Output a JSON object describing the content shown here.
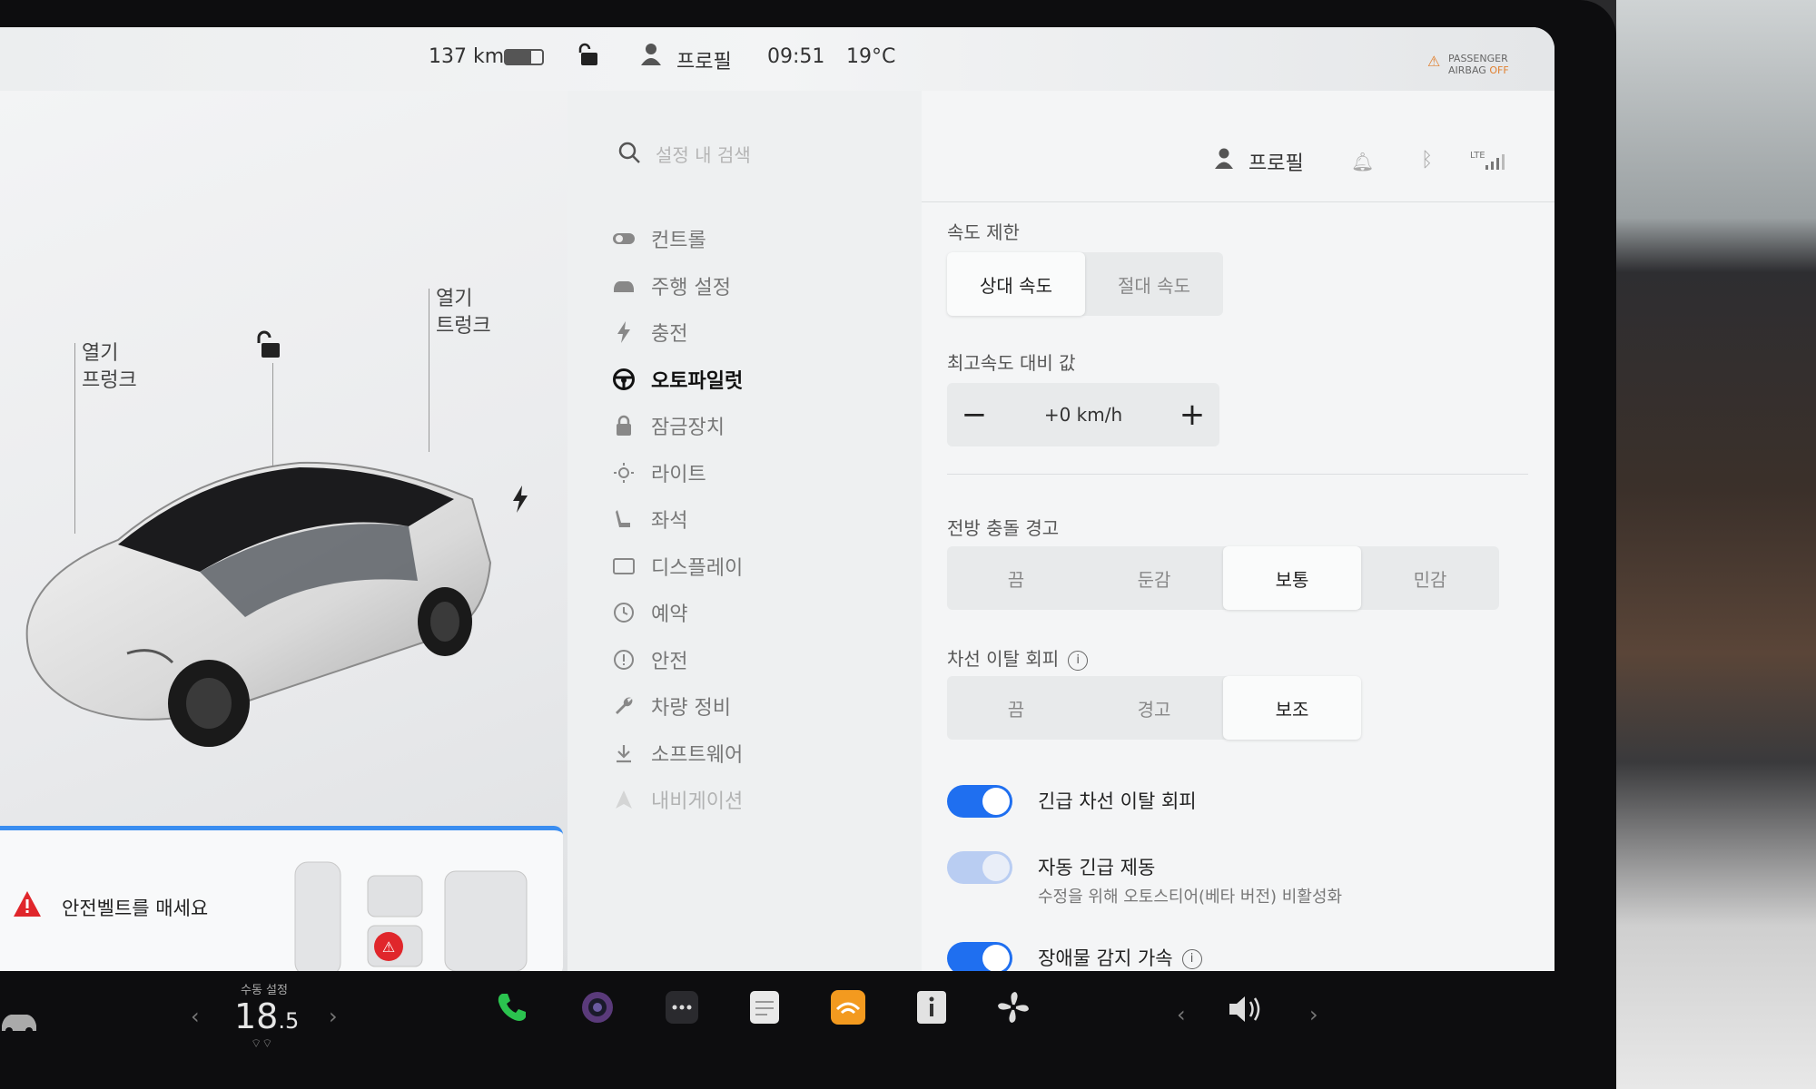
{
  "status_bar": {
    "range": "137 km",
    "battery_level": 0.7,
    "profile": "프로필",
    "time": "09:51",
    "temperature": "19°C",
    "airbag_line1": "PASSENGER",
    "airbag_line2": "AIRBAG",
    "airbag_state": "OFF"
  },
  "left_panel": {
    "frunk_state": "열기",
    "frunk_label": "프렁크",
    "trunk_state": "열기",
    "trunk_label": "트렁크",
    "alert_text": "안전벨트를 매세요"
  },
  "search": {
    "placeholder": "설정 내 검색"
  },
  "menu": {
    "items": [
      {
        "label": "컨트롤",
        "icon": "toggle-icon"
      },
      {
        "label": "주행 설정",
        "icon": "car-icon"
      },
      {
        "label": "충전",
        "icon": "lightning-icon"
      },
      {
        "label": "오토파일럿",
        "icon": "steering-wheel-icon",
        "active": true
      },
      {
        "label": "잠금장치",
        "icon": "lock-icon"
      },
      {
        "label": "라이트",
        "icon": "light-icon"
      },
      {
        "label": "좌석",
        "icon": "seat-icon"
      },
      {
        "label": "디스플레이",
        "icon": "display-icon"
      },
      {
        "label": "예약",
        "icon": "clock-icon"
      },
      {
        "label": "안전",
        "icon": "safety-icon"
      },
      {
        "label": "차량 정비",
        "icon": "wrench-icon"
      },
      {
        "label": "소프트웨어",
        "icon": "download-icon"
      },
      {
        "label": "내비게이션",
        "icon": "navigation-icon"
      }
    ]
  },
  "content": {
    "profile": "프로필",
    "lte": "LTE",
    "speed_limit": {
      "label": "속도 제한",
      "options": [
        "상대 속도",
        "절대 속도"
      ],
      "selected": 0
    },
    "offset": {
      "label": "최고속도 대비 값",
      "minus": "−",
      "value": "+0 km/h",
      "plus": "+"
    },
    "fcw": {
      "label": "전방 충돌 경고",
      "options": [
        "끔",
        "둔감",
        "보통",
        "민감"
      ],
      "selected": 2
    },
    "lane_departure": {
      "label": "차선 이탈 회피",
      "info": "i",
      "options": [
        "끔",
        "경고",
        "보조"
      ],
      "selected": 2
    },
    "toggles": {
      "emergency_lane": {
        "label": "긴급 차선 이탈 회피",
        "on": true
      },
      "aeb": {
        "label": "자동 긴급 제동",
        "sub": "수정을 위해 오토스티어(베타 버전) 비활성화",
        "on": true
      },
      "obstacle": {
        "label": "장애물 감지 가속",
        "info": "i",
        "on": true
      }
    }
  },
  "taskbar": {
    "temp_label": "수동 설정",
    "temp_int": "18",
    "temp_dec": ".5",
    "chev_left": "‹",
    "chev_right": "›",
    "vol_left": "‹",
    "vol_right": "›",
    "apps": [
      "phone-icon",
      "camera-icon",
      "more-icon",
      "notes-icon",
      "audible-icon",
      "manual-icon",
      "fan-icon"
    ]
  }
}
